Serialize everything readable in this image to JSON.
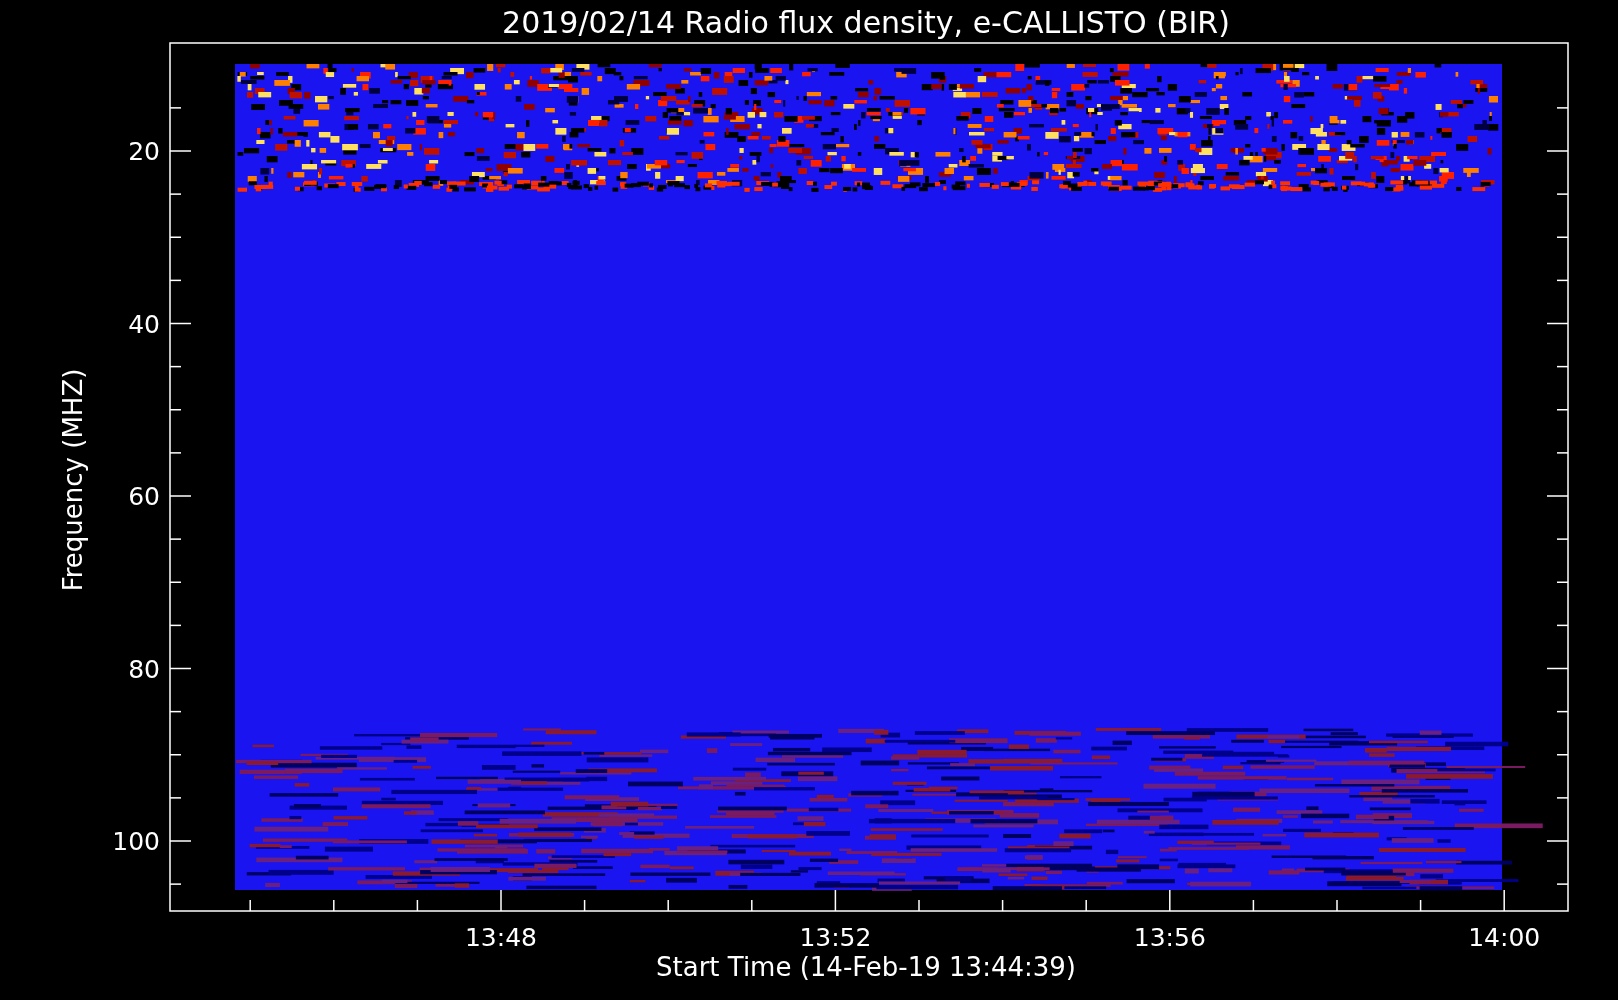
{
  "title": "2019/02/14  Radio flux density, e-CALLISTO (BIR)",
  "y_axis": {
    "label": "Frequency (MHZ)",
    "ticks": [
      "20",
      "40",
      "60",
      "80",
      "100"
    ]
  },
  "x_axis": {
    "label": "Start Time (14-Feb-19 13:44:39)",
    "ticks": [
      "13:48",
      "13:52",
      "13:56",
      "14:00"
    ]
  }
}
